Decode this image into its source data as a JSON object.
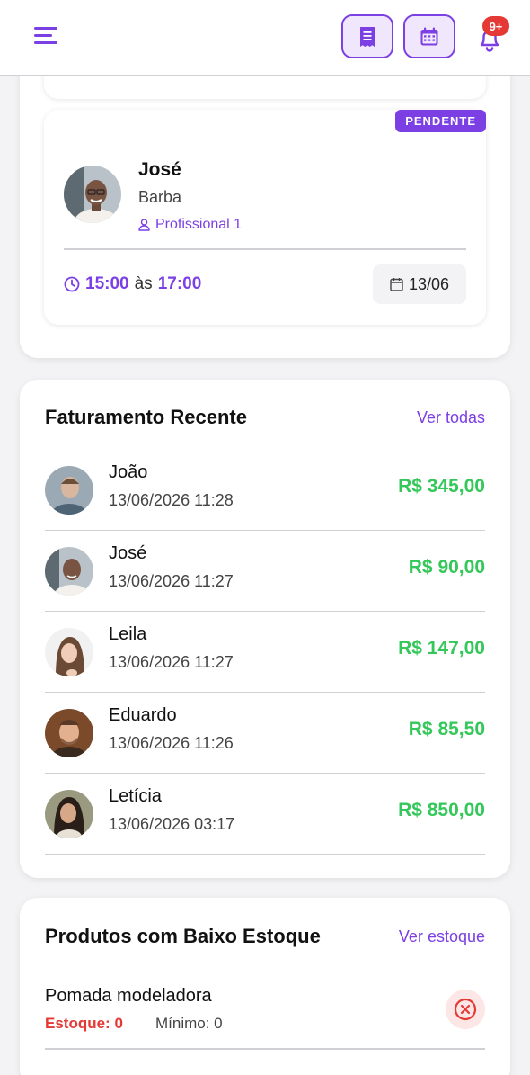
{
  "header": {
    "notifications_badge": "9+",
    "icons": [
      "menu-icon",
      "receipt-icon",
      "calendar-icon",
      "bell-icon"
    ]
  },
  "appointment": {
    "status": "PENDENTE",
    "client_name": "José",
    "service": "Barba",
    "professional": "Profissional 1",
    "start_time": "15:00",
    "separator": "às",
    "end_time": "17:00",
    "date": "13/06"
  },
  "billing": {
    "title": "Faturamento Recente",
    "link": "Ver todas",
    "items": [
      {
        "name": "João",
        "datetime": "13/06/2026 11:28",
        "value": "R$ 345,00"
      },
      {
        "name": "José",
        "datetime": "13/06/2026 11:27",
        "value": "R$ 90,00"
      },
      {
        "name": "Leila",
        "datetime": "13/06/2026 11:27",
        "value": "R$ 147,00"
      },
      {
        "name": "Eduardo",
        "datetime": "13/06/2026 11:26",
        "value": "R$ 85,50"
      },
      {
        "name": "Letícia",
        "datetime": "13/06/2026 03:17",
        "value": "R$ 850,00"
      }
    ]
  },
  "stock": {
    "title": "Produtos com Baixo Estoque",
    "link": "Ver estoque",
    "items": [
      {
        "name": "Pomada modeladora",
        "quantity": "Estoque: 0",
        "minimum": "Mínimo: 0"
      }
    ]
  },
  "colors": {
    "accent": "#7b3fe4",
    "success": "#34c759",
    "danger": "#e53935"
  }
}
